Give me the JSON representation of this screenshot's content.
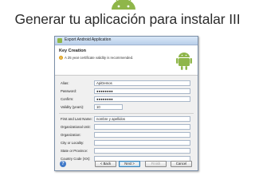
{
  "slide": {
    "title": "Generar tu aplicación para instalar III"
  },
  "dialog": {
    "window_title": "Export Android Application",
    "banner_title": "Key Creation",
    "banner_message": "A 25 year certificate validity is recommended.",
    "fields": [
      {
        "label": "Alias:",
        "value": ""
      },
      {
        "label": "Password:",
        "value": "●●●●●●●●"
      },
      {
        "label": "Confirm:",
        "value": "●●●●●●●●"
      },
      {
        "label": "Validity (years):",
        "value": "10"
      },
      {
        "label": "First and Last Name:",
        "value": "nombre y apellidos"
      },
      {
        "label": "Organizational Unit:",
        "value": ""
      },
      {
        "label": "Organization:",
        "value": ""
      },
      {
        "label": "City or Locality:",
        "value": ""
      },
      {
        "label": "State or Province:",
        "value": ""
      },
      {
        "label": "Country Code (XX):",
        "value": ""
      }
    ],
    "alias_value": "ApiDemos",
    "buttons": {
      "back": "< Back",
      "next": "Next >",
      "finish": "Finish",
      "cancel": "Cancel"
    }
  },
  "icons": {
    "logo": "android-logo-icon",
    "help": "help-icon",
    "warning": "warning-icon"
  },
  "colors": {
    "android_green": "#8fb64a",
    "title_text": "#2b2b2b"
  }
}
